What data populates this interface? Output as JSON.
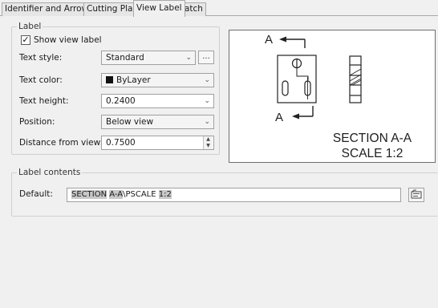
{
  "tabs": [
    {
      "label": "Identifier and Arrows"
    },
    {
      "label": "Cutting Plane"
    },
    {
      "label": "View Label"
    },
    {
      "label": "Hatch"
    }
  ],
  "active_tab": "View Label",
  "label_group": {
    "title": "Label",
    "show_view_label": {
      "label": "Show view label",
      "checked": true
    },
    "text_style": {
      "label": "Text style:",
      "value": "Standard",
      "browse": "..."
    },
    "text_color": {
      "label": "Text color:",
      "value": "ByLayer",
      "swatch": "#111111"
    },
    "text_height": {
      "label": "Text height:",
      "value": "0.2400"
    },
    "position": {
      "label": "Position:",
      "value": "Below view"
    },
    "distance": {
      "label": "Distance from view:",
      "value": "0.7500"
    }
  },
  "preview": {
    "marker_top": "A",
    "marker_bottom": "A",
    "caption_line1": "SECTION A-A",
    "caption_line2": "SCALE 1:2"
  },
  "contents_group": {
    "title": "Label contents",
    "default_label": "Default:",
    "default_value": {
      "part1": "SECTION",
      "part2": " ",
      "part3": "A-A",
      "part4": "\\PSCALE ",
      "part5": "1:2"
    }
  }
}
